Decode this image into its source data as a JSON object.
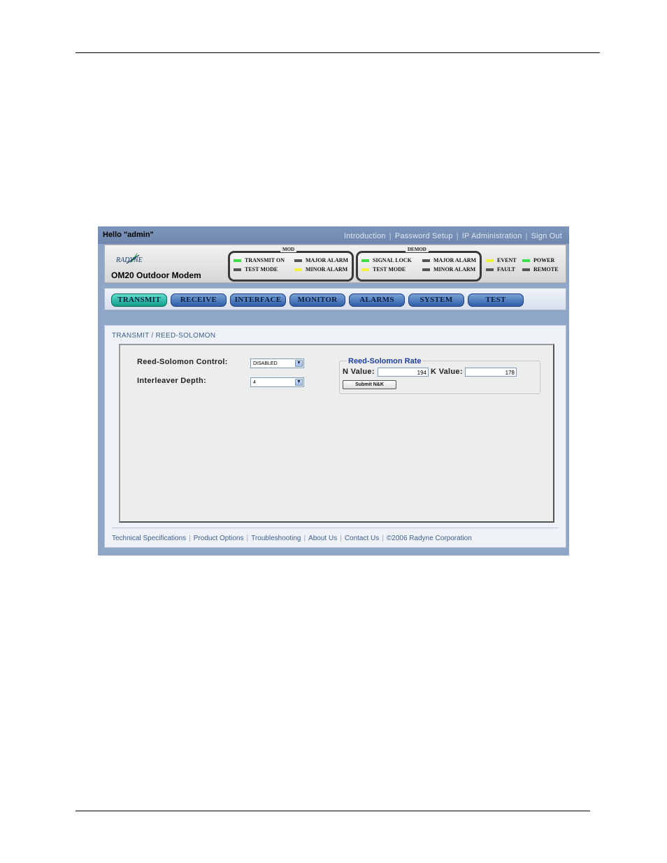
{
  "greeting": "Hello \"admin\"",
  "top_links": [
    "Introduction",
    "Password Setup",
    "IP Administration",
    "Sign Out"
  ],
  "brand": {
    "logo_text": "RADYNE",
    "model": "OM20 Outdoor Modem"
  },
  "status": {
    "mod": {
      "title": "MOD",
      "indicators": [
        {
          "label": "TRANSMIT ON",
          "color": "green"
        },
        {
          "label": "TEST MODE",
          "color": "gray"
        },
        {
          "label": "MAJOR ALARM",
          "color": "gray"
        },
        {
          "label": "MINOR ALARM",
          "color": "yellow"
        }
      ]
    },
    "demod": {
      "title": "DEMOD",
      "indicators": [
        {
          "label": "SIGNAL LOCK",
          "color": "green"
        },
        {
          "label": "TEST MODE",
          "color": "yellow"
        },
        {
          "label": "MAJOR ALARM",
          "color": "gray"
        },
        {
          "label": "MINOR ALARM",
          "color": "gray"
        }
      ]
    },
    "extra": [
      {
        "label": "EVENT",
        "color": "yellow"
      },
      {
        "label": "FAULT",
        "color": "gray"
      },
      {
        "label": "POWER",
        "color": "green"
      },
      {
        "label": "REMOTE",
        "color": "gray"
      }
    ]
  },
  "tabs": [
    "TRANSMIT",
    "RECEIVE",
    "INTERFACE",
    "MONITOR",
    "ALARMS",
    "SYSTEM",
    "TEST"
  ],
  "active_tab": "TRANSMIT",
  "breadcrumb": "TRANSMIT / REED-SOLOMON",
  "form": {
    "rs_control_label": "Reed-Solomon Control:",
    "rs_control_value": "DISABLED",
    "interleaver_label": "Interleaver Depth:",
    "interleaver_value": "4"
  },
  "rs_rate": {
    "title": "Reed-Solomon Rate",
    "n_label": "N Value:",
    "n_value": "194",
    "k_label": "K Value:",
    "k_value": "178",
    "submit_label": "Submit N&K"
  },
  "footer_links": [
    "Technical Specifications",
    "Product Options",
    "Troubleshooting",
    "About Us",
    "Contact Us",
    "©2006 Radyne Corporation"
  ],
  "colors": {
    "led_green": "#3ce046",
    "led_yellow": "#f2f23c",
    "led_gray": "#555555",
    "active_tab": "#109c8c",
    "tab": "#2f5ea8",
    "link": "#3d5e8d"
  }
}
